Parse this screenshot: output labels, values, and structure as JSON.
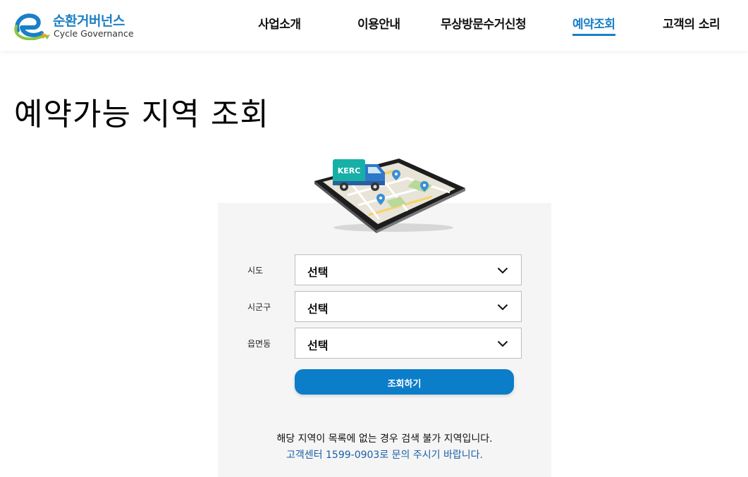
{
  "header": {
    "logo": {
      "ko": "순환거버넌스",
      "en": "Cycle Governance"
    },
    "nav": [
      {
        "label": "사업소개",
        "active": false
      },
      {
        "label": "이용안내",
        "active": false
      },
      {
        "label": "무상방문수거신청",
        "active": false
      },
      {
        "label": "예약조회",
        "active": true
      },
      {
        "label": "고객의 소리",
        "active": false
      }
    ]
  },
  "main": {
    "title": "예약가능 지역 조회",
    "illustration": {
      "truck_label": "KERC",
      "icon": "tablet-map-truck-illustration"
    },
    "form": {
      "fields": [
        {
          "label": "시도",
          "value": "선택"
        },
        {
          "label": "시군구",
          "value": "선택"
        },
        {
          "label": "읍면동",
          "value": "선택"
        }
      ],
      "submit_label": "조회하기"
    },
    "notice": {
      "line1": "해당 지역이 목록에 없는 경우 검색 불가 지역입니다.",
      "line2": "고객센터 1599-0903로 문의 주시기 바랍니다."
    }
  },
  "colors": {
    "brand_blue": "#1a7fc6",
    "button_blue": "#0b7dc9",
    "panel_bg": "#f5f5f5",
    "truck_teal": "#16b0a6"
  }
}
